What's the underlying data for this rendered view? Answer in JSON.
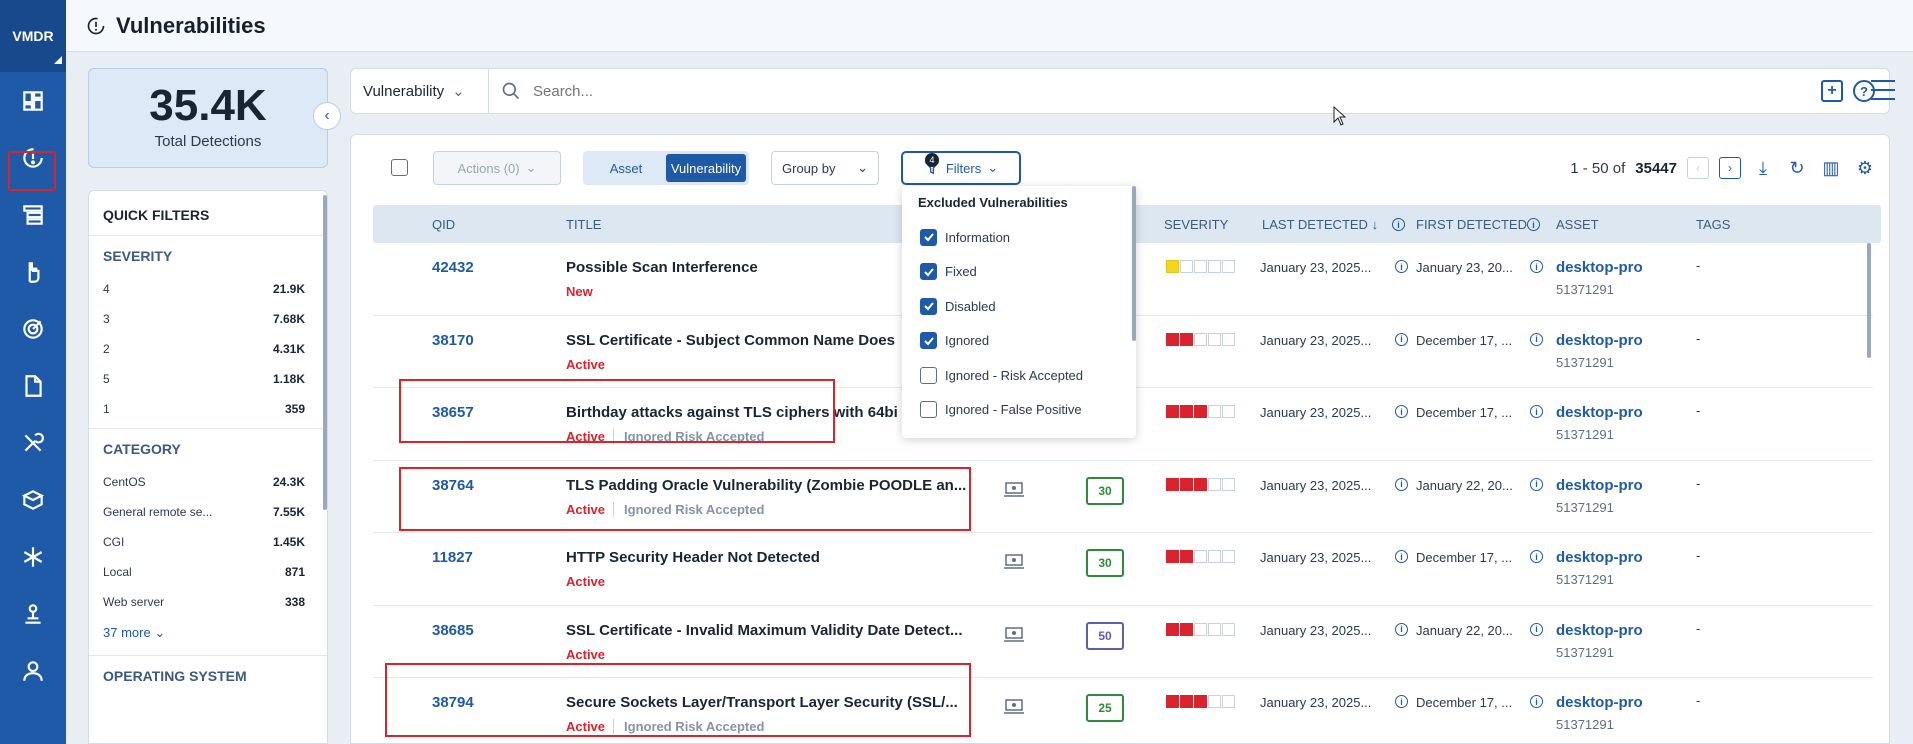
{
  "app": {
    "brand": "VMDR",
    "page_title": "Vulnerabilities"
  },
  "nav": [
    "dashboard-icon",
    "vulnerabilities-icon",
    "inventory-icon",
    "prioritize-icon",
    "scans-icon",
    "reports-icon",
    "remediation-icon",
    "assets-icon",
    "configuration-icon",
    "connectors-icon",
    "users-icon"
  ],
  "summary": {
    "value": "35.4K",
    "label": "Total Detections"
  },
  "quick_filters": {
    "title": "QUICK FILTERS",
    "severity": {
      "title": "SEVERITY",
      "items": [
        {
          "label": "4",
          "count": "21.9K"
        },
        {
          "label": "3",
          "count": "7.68K"
        },
        {
          "label": "2",
          "count": "4.31K"
        },
        {
          "label": "5",
          "count": "1.18K"
        },
        {
          "label": "1",
          "count": "359"
        }
      ]
    },
    "category": {
      "title": "CATEGORY",
      "items": [
        {
          "label": "CentOS",
          "count": "24.3K"
        },
        {
          "label": "General remote se...",
          "count": "7.55K"
        },
        {
          "label": "CGI",
          "count": "1.45K"
        },
        {
          "label": "Local",
          "count": "871"
        },
        {
          "label": "Web server",
          "count": "338"
        }
      ],
      "more": "37 more"
    },
    "os_title": "OPERATING SYSTEM"
  },
  "search": {
    "scope": "Vulnerability",
    "placeholder": "Search..."
  },
  "toolbar": {
    "actions": "Actions (0)",
    "toggle": [
      "Asset",
      "Vulnerability"
    ],
    "group_by": "Group by",
    "filters": "Filters",
    "filter_count": "4",
    "paging_range": "1 - 50 of",
    "paging_total": "35447"
  },
  "columns": {
    "qid": "QID",
    "title": "TITLE",
    "severity": "SEVERITY",
    "last": "LAST DETECTED",
    "first": "FIRST DETECTED",
    "asset": "ASSET",
    "tags": "TAGS"
  },
  "filter_dropdown": {
    "heading": "Excluded Vulnerabilities",
    "options": [
      {
        "label": "Information",
        "checked": true
      },
      {
        "label": "Fixed",
        "checked": true
      },
      {
        "label": "Disabled",
        "checked": true
      },
      {
        "label": "Ignored",
        "checked": true
      },
      {
        "label": "Ignored - Risk Accepted",
        "checked": false
      },
      {
        "label": "Ignored - False Positive",
        "checked": false
      }
    ]
  },
  "rows": [
    {
      "qid": "42432",
      "title": "Possible Scan Interference",
      "status": "New",
      "sub": "",
      "score": "",
      "severity": 1,
      "sev_color": "yellow",
      "last": "January 23, 2025...",
      "first": "January 23, 20...",
      "asset": "desktop-pro",
      "asset_id": "51371291",
      "tags": "-"
    },
    {
      "qid": "38170",
      "title": "SSL Certificate - Subject Common Name Does",
      "status": "Active",
      "sub": "",
      "score": "",
      "severity": 2,
      "sev_color": "red",
      "last": "January 23, 2025...",
      "first": "December 17, ...",
      "asset": "desktop-pro",
      "asset_id": "51371291",
      "tags": "-"
    },
    {
      "qid": "38657",
      "title": "Birthday attacks against TLS ciphers with 64bi",
      "status": "Active",
      "sub": "Ignored Risk Accepted",
      "score": "",
      "severity": 3,
      "sev_color": "red",
      "last": "January 23, 2025...",
      "first": "December 17, ...",
      "asset": "desktop-pro",
      "asset_id": "51371291",
      "tags": "-"
    },
    {
      "qid": "38764",
      "title": "TLS Padding Oracle Vulnerability (Zombie POODLE an...",
      "status": "Active",
      "sub": "Ignored Risk Accepted",
      "score": "30",
      "severity": 3,
      "sev_color": "red",
      "last": "January 23, 2025...",
      "first": "January 22, 20...",
      "asset": "desktop-pro",
      "asset_id": "51371291",
      "tags": "-"
    },
    {
      "qid": "11827",
      "title": "HTTP Security Header Not Detected",
      "status": "Active",
      "sub": "",
      "score": "30",
      "severity": 2,
      "sev_color": "red",
      "last": "January 23, 2025...",
      "first": "December 17, ...",
      "asset": "desktop-pro",
      "asset_id": "51371291",
      "tags": "-"
    },
    {
      "qid": "38685",
      "title": "SSL Certificate - Invalid Maximum Validity Date Detect...",
      "status": "Active",
      "sub": "",
      "score": "50",
      "severity": 2,
      "sev_color": "red",
      "last": "January 23, 2025...",
      "first": "January 22, 20...",
      "asset": "desktop-pro",
      "asset_id": "51371291",
      "tags": "-"
    },
    {
      "qid": "38794",
      "title": "Secure Sockets Layer/Transport Layer Security (SSL/...",
      "status": "Active",
      "sub": "Ignored Risk Accepted",
      "score": "25",
      "severity": 3,
      "sev_color": "red",
      "last": "January 23, 2025...",
      "first": "December 17, ...",
      "asset": "desktop-pro",
      "asset_id": "51371291",
      "tags": "-"
    }
  ]
}
